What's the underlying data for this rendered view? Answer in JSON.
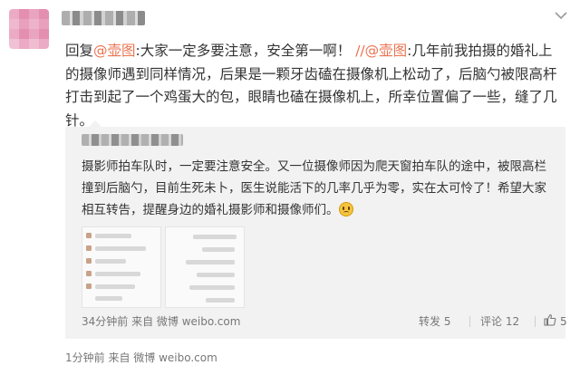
{
  "post": {
    "reply_prefix": "回复",
    "mention1": "@壶图",
    "text_part1": ":大家一定多要注意，安全第一啊！ ",
    "repost_marker": "//",
    "mention2": "@壶图",
    "text_part2": ":几年前我拍摄的婚礼上的摄像师遇到同样情况，后果是一颗牙齿磕在摄像机上松动了，后脑勺被限高杆打击到起了一个鸡蛋大的包，眼睛也磕在摄像机上，所幸位置偏了一些，缝了几针。"
  },
  "quoted": {
    "text": "摄影师拍车队时，一定要注意安全。又一位摄像师因为爬天窗拍车队的途中，被限高栏撞到后脑勺，目前生死未卜，医生说能活下的几率几乎为零，实在太可怜了！希望大家相互转告，提醒身边的婚礼摄影师和摄像师们。",
    "emoji_icon": "crying-face-icon",
    "footer": {
      "time_source": "34分钟前 来自 微博 weibo.com",
      "repost": "转发 5",
      "comment": "评论 12",
      "like_count": "5"
    }
  },
  "footer": {
    "time_source": "1分钟前 来自 微博 weibo.com"
  },
  "icons": {
    "more": "chevron-down-icon",
    "like": "thumbs-up-icon"
  },
  "colors": {
    "accent": "#eb7350",
    "quote_bg": "#f2f2f2"
  }
}
